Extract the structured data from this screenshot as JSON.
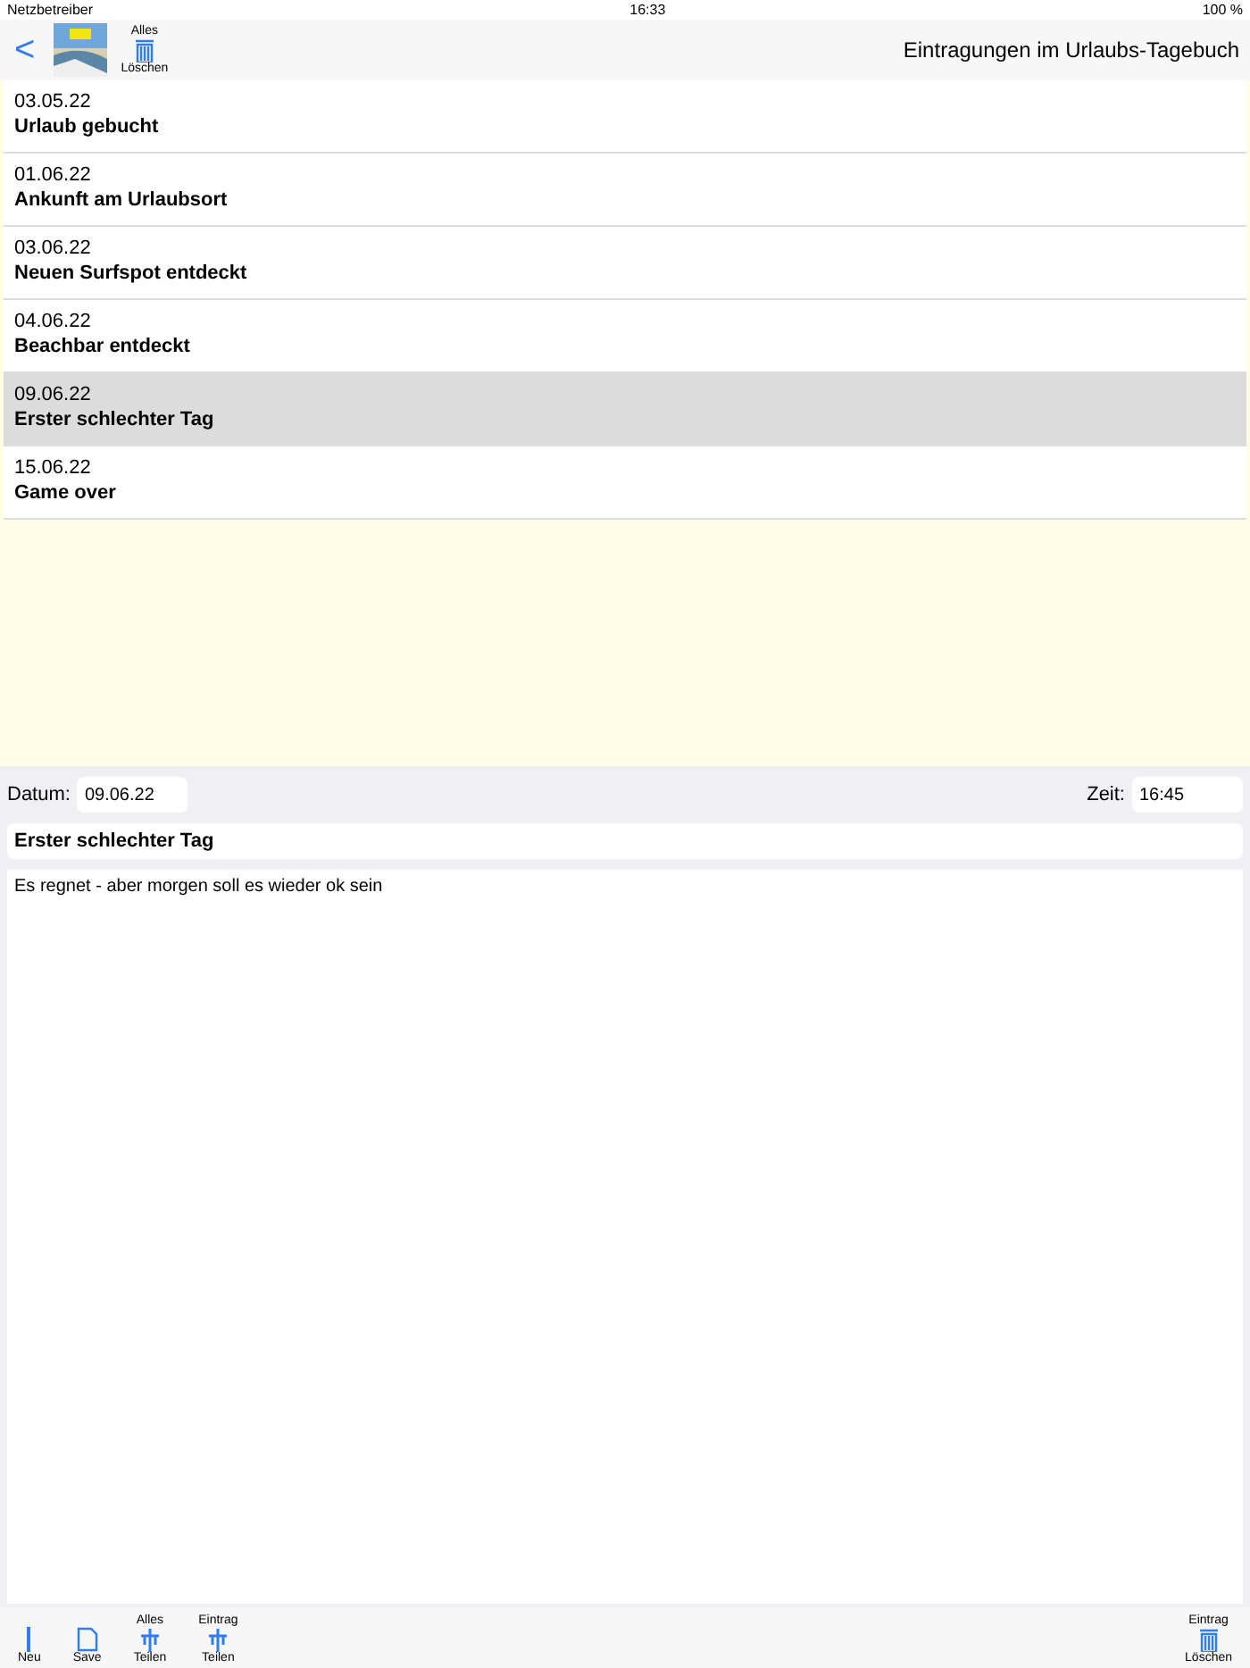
{
  "status_bar": {
    "carrier": "Netzbetreiber",
    "time": "16:33",
    "battery": "100 %"
  },
  "nav_bar": {
    "back": "<",
    "delete_all": {
      "top": "Alles",
      "label": "Löschen"
    },
    "title": "Eintragungen im Urlaubs-Tagebuch"
  },
  "entries": [
    {
      "date": "03.05.22",
      "title": "Urlaub gebucht",
      "selected": false
    },
    {
      "date": "01.06.22",
      "title": "Ankunft am Urlaubsort",
      "selected": false
    },
    {
      "date": "03.06.22",
      "title": "Neuen Surfspot entdeckt",
      "selected": false
    },
    {
      "date": "04.06.22",
      "title": "Beachbar entdeckt",
      "selected": false
    },
    {
      "date": "09.06.22",
      "title": "Erster schlechter Tag",
      "selected": true
    },
    {
      "date": "15.06.22",
      "title": "Game over",
      "selected": false
    }
  ],
  "detail": {
    "date_label": "Datum:",
    "date": "09.06.22",
    "time_label": "Zeit:",
    "time": "16:45",
    "title": "Erster schlechter Tag",
    "text": "Es regnet - aber morgen soll es wieder ok sein"
  },
  "toolbar": {
    "left": [
      {
        "kind": "new",
        "label": "Neu"
      },
      {
        "kind": "save",
        "label": "Save"
      },
      {
        "kind": "share",
        "top": "Alles",
        "label": "Teilen"
      },
      {
        "kind": "share",
        "top": "Eintrag",
        "label": "Teilen"
      }
    ],
    "right": [
      {
        "kind": "delete",
        "top": "Eintrag",
        "label": "Löschen"
      }
    ]
  }
}
